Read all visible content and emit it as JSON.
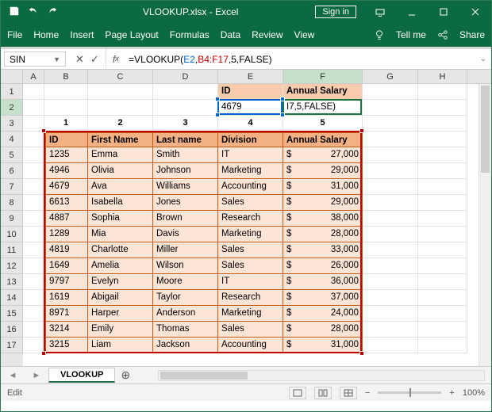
{
  "title": {
    "filename": "VLOOKUP.xlsx",
    "app": "Excel",
    "combined": "VLOOKUP.xlsx - Excel"
  },
  "signin": "Sign in",
  "ribbon": {
    "file": "File",
    "home": "Home",
    "insert": "Insert",
    "page_layout": "Page Layout",
    "formulas": "Formulas",
    "data": "Data",
    "review": "Review",
    "view": "View",
    "tell_me": "Tell me",
    "share": "Share"
  },
  "name_box": "SIN",
  "formula": {
    "raw": "=VLOOKUP(E2,B4:F17,5,FALSE)",
    "pre": "=VLOOKUP(",
    "arg1": "E2",
    "sep1": ",",
    "arg2": "B4:F17",
    "post": ",5,FALSE)"
  },
  "lookup_row": {
    "id_label": "ID",
    "salary_label": "Annual Salary",
    "id_value": "4679",
    "editing_text": "I7,5,FALSE)"
  },
  "col_index_labels": [
    "1",
    "2",
    "3",
    "4",
    "5"
  ],
  "table_headers": {
    "id": "ID",
    "first": "First Name",
    "last": "Last name",
    "division": "Division",
    "salary": "Annual Salary"
  },
  "rows": [
    {
      "id": "1235",
      "first": "Emma",
      "last": "Smith",
      "division": "IT",
      "salary": "27,000"
    },
    {
      "id": "4946",
      "first": "Olivia",
      "last": "Johnson",
      "division": "Marketing",
      "salary": "29,000"
    },
    {
      "id": "4679",
      "first": "Ava",
      "last": "Williams",
      "division": "Accounting",
      "salary": "31,000"
    },
    {
      "id": "6613",
      "first": "Isabella",
      "last": "Jones",
      "division": "Sales",
      "salary": "29,000"
    },
    {
      "id": "4887",
      "first": "Sophia",
      "last": "Brown",
      "division": "Research",
      "salary": "38,000"
    },
    {
      "id": "1289",
      "first": "Mia",
      "last": "Davis",
      "division": "Marketing",
      "salary": "28,000"
    },
    {
      "id": "4819",
      "first": "Charlotte",
      "last": "Miller",
      "division": "Sales",
      "salary": "33,000"
    },
    {
      "id": "1649",
      "first": "Amelia",
      "last": "Wilson",
      "division": "Sales",
      "salary": "26,000"
    },
    {
      "id": "9797",
      "first": "Evelyn",
      "last": "Moore",
      "division": "IT",
      "salary": "36,000"
    },
    {
      "id": "1619",
      "first": "Abigail",
      "last": "Taylor",
      "division": "Research",
      "salary": "37,000"
    },
    {
      "id": "8971",
      "first": "Harper",
      "last": "Anderson",
      "division": "Marketing",
      "salary": "24,000"
    },
    {
      "id": "3214",
      "first": "Emily",
      "last": "Thomas",
      "division": "Sales",
      "salary": "28,000"
    },
    {
      "id": "3215",
      "first": "Liam",
      "last": "Jackson",
      "division": "Accounting",
      "salary": "31,000"
    }
  ],
  "currency": "$",
  "sheet_tab": "VLOOKUP",
  "status_mode": "Edit",
  "zoom": "100%"
}
